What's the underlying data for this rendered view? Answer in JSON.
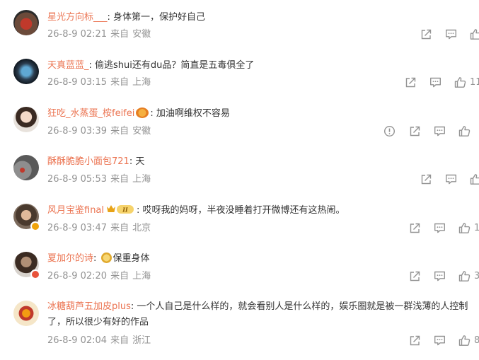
{
  "colors": {
    "username": "#eb7350",
    "meta": "#939393",
    "text": "#333333",
    "icon": "#939393"
  },
  "comments": [
    {
      "username": "星光方向标___",
      "text": "身体第一，保护好自己",
      "time": "26-8-9 02:21",
      "from": "来自",
      "location": "安徽",
      "likes": ""
    },
    {
      "username": "天真蓝蓝_",
      "text": "偷逃shui还有du品？简直是五毒俱全了",
      "time": "26-8-9 03:15",
      "from": "来自",
      "location": "上海",
      "likes": "11"
    },
    {
      "username": "狂吃_水蒸蛋_桉feifei",
      "text": "加油啊维权不容易",
      "time": "26-8-9 03:39",
      "from": "来自",
      "location": "安徽",
      "likes": ""
    },
    {
      "username": "酥酥脆脆小面包721",
      "text": "天",
      "time": "26-8-9 05:53",
      "from": "来自",
      "location": "上海",
      "likes": ""
    },
    {
      "username": "风月宝鉴final",
      "text": "哎呀我的妈呀，半夜没睡着打开微博还有这热闹。",
      "time": "26-8-9 03:47",
      "from": "来自",
      "location": "北京",
      "likes": "1"
    },
    {
      "username": "夏加尔的诗",
      "text": "保重身体",
      "time": "26-8-9 02:20",
      "from": "来自",
      "location": "上海",
      "likes": "3"
    },
    {
      "username": "冰糖葫芦五加皮plus",
      "text": "一个人自己是什么样的，就会看别人是什么样的，娱乐圈就是被一群浅薄的人控制了，所以很少有好的作品",
      "time": "26-8-9 02:04",
      "from": "来自",
      "location": "浙江",
      "likes": "8"
    }
  ],
  "badges": {
    "crown_level": "II"
  },
  "icons": {
    "share": "share-icon",
    "reply": "comment-icon",
    "like": "thumbs-up-icon",
    "report": "report-icon"
  }
}
